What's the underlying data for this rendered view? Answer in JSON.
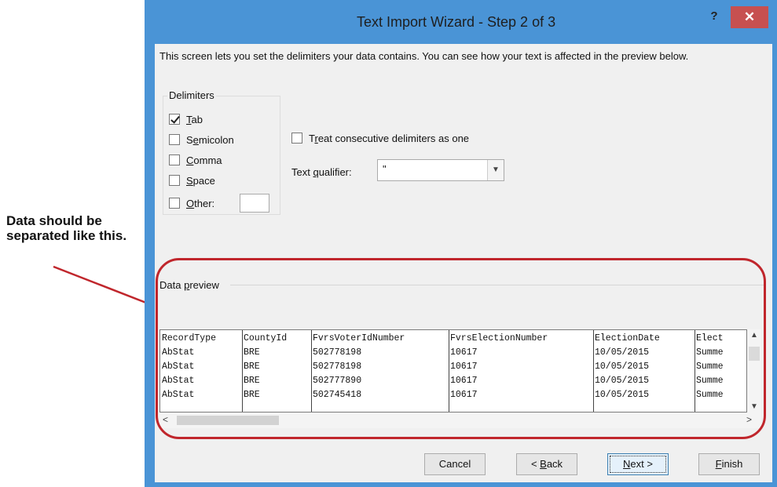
{
  "annotation": {
    "text": "Data should be separated like this."
  },
  "dialog": {
    "title": "Text Import Wizard - Step 2 of 3",
    "help": "?",
    "close": "✕",
    "intro": "This screen lets you set the delimiters your data contains.  You can see how your text is affected in the preview below."
  },
  "delimiters": {
    "group_label": "Delimiters",
    "tab": {
      "label": "Tab",
      "checked": true
    },
    "semicolon": {
      "label": "Semicolon",
      "checked": false
    },
    "comma": {
      "label": "Comma",
      "checked": false
    },
    "space": {
      "label": "Space",
      "checked": false
    },
    "other": {
      "label": "Other:",
      "checked": false,
      "value": ""
    }
  },
  "consecutive": {
    "label": "Treat consecutive delimiters as one",
    "checked": false
  },
  "qualifier": {
    "label": "Text qualifier:",
    "value": "\""
  },
  "preview": {
    "label": "Data preview",
    "rows": [
      [
        "RecordType",
        "CountyId",
        "FvrsVoterIdNumber",
        "FvrsElectionNumber",
        "ElectionDate",
        "Elect"
      ],
      [
        "AbStat",
        "BRE",
        "502778198",
        "10617",
        "10/05/2015",
        "Summe"
      ],
      [
        "AbStat",
        "BRE",
        "502778198",
        "10617",
        "10/05/2015",
        "Summe"
      ],
      [
        "AbStat",
        "BRE",
        "502777890",
        "10617",
        "10/05/2015",
        "Summe"
      ],
      [
        "AbStat",
        "BRE",
        "502745418",
        "10617",
        "10/05/2015",
        "Summe"
      ]
    ]
  },
  "buttons": {
    "cancel": "Cancel",
    "back": "< Back",
    "next": "Next >",
    "finish": "Finish"
  },
  "colors": {
    "frame": "#4a94d6",
    "close": "#c75050",
    "highlight": "#c0262c"
  }
}
